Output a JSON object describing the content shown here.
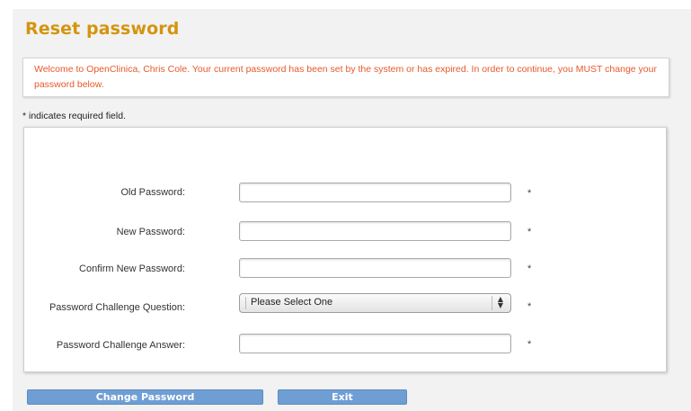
{
  "page": {
    "title": "Reset password",
    "alert_message": "Welcome to OpenClinica, Chris Cole. Your current password has been set by the system or has expired. In order to continue, you MUST change your password below.",
    "required_note": "* indicates required field."
  },
  "form": {
    "old_password": {
      "label": "Old Password:",
      "value": ""
    },
    "new_password": {
      "label": "New Password:",
      "value": ""
    },
    "confirm_password": {
      "label": "Confirm New Password:",
      "value": ""
    },
    "challenge_question": {
      "label": "Password Challenge Question:",
      "selected": "Please Select One"
    },
    "challenge_answer": {
      "label": "Password Challenge Answer:",
      "value": ""
    },
    "required_marker": "*"
  },
  "buttons": {
    "change_password": "Change Password",
    "exit": "Exit"
  },
  "colors": {
    "title": "#d4940e",
    "alert_text": "#e8592b",
    "button": "#6f9ed4"
  }
}
